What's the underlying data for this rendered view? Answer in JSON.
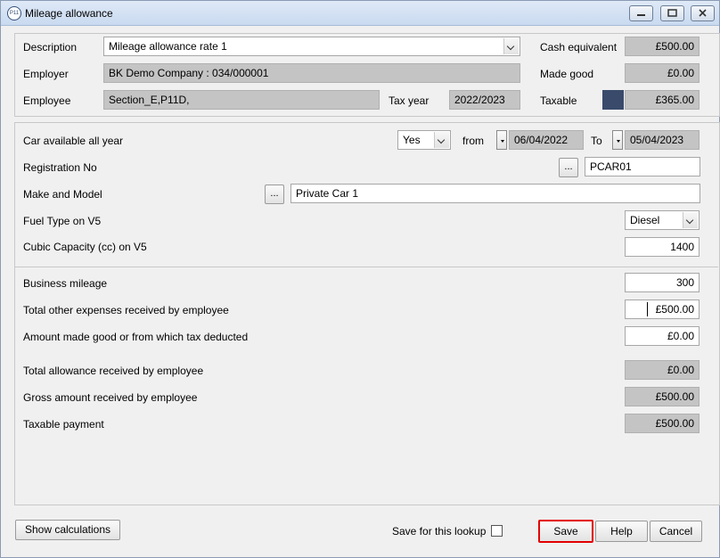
{
  "window": {
    "title": "Mileage allowance"
  },
  "header": {
    "description_label": "Description",
    "description_value": "Mileage allowance rate 1",
    "employer_label": "Employer",
    "employer_value": "BK Demo Company : 034/000001",
    "employee_label": "Employee",
    "employee_value": "Section_E,P11D,",
    "tax_year_label": "Tax year",
    "tax_year_value": "2022/2023",
    "cash_equivalent_label": "Cash equivalent",
    "cash_equivalent_value": "£500.00",
    "made_good_label": "Made good",
    "made_good_value": "£0.00",
    "taxable_label": "Taxable",
    "taxable_value": "£365.00",
    "taxable_color": "#3a4a6b"
  },
  "car": {
    "available_label": "Car available all year",
    "available_value": "Yes",
    "from_label": "from",
    "from_value": "06/04/2022",
    "to_label": "To",
    "to_value": "05/04/2023",
    "registration_label": "Registration No",
    "registration_button": "...",
    "registration_value": "PCAR01",
    "make_model_label": "Make and Model",
    "make_model_button": "...",
    "make_model_value": "Private Car 1",
    "fuel_label": "Fuel Type on V5",
    "fuel_value": "Diesel",
    "cc_label": "Cubic Capacity (cc) on V5",
    "cc_value": "1400"
  },
  "expenses": {
    "business_mileage_label": "Business mileage",
    "business_mileage_value": "300",
    "other_expenses_label": "Total other expenses received by employee",
    "other_expenses_value": "£500.00",
    "made_good_label": "Amount made good or from which tax deducted",
    "made_good_value": "£0.00",
    "total_allowance_label": "Total allowance received by employee",
    "total_allowance_value": "£0.00",
    "gross_amount_label": "Gross amount received by employee",
    "gross_amount_value": "£500.00",
    "taxable_payment_label": "Taxable payment",
    "taxable_payment_value": "£500.00"
  },
  "footer": {
    "show_calculations": "Show calculations",
    "save_lookup_label": "Save for this lookup",
    "save": "Save",
    "help": "Help",
    "cancel": "Cancel"
  }
}
